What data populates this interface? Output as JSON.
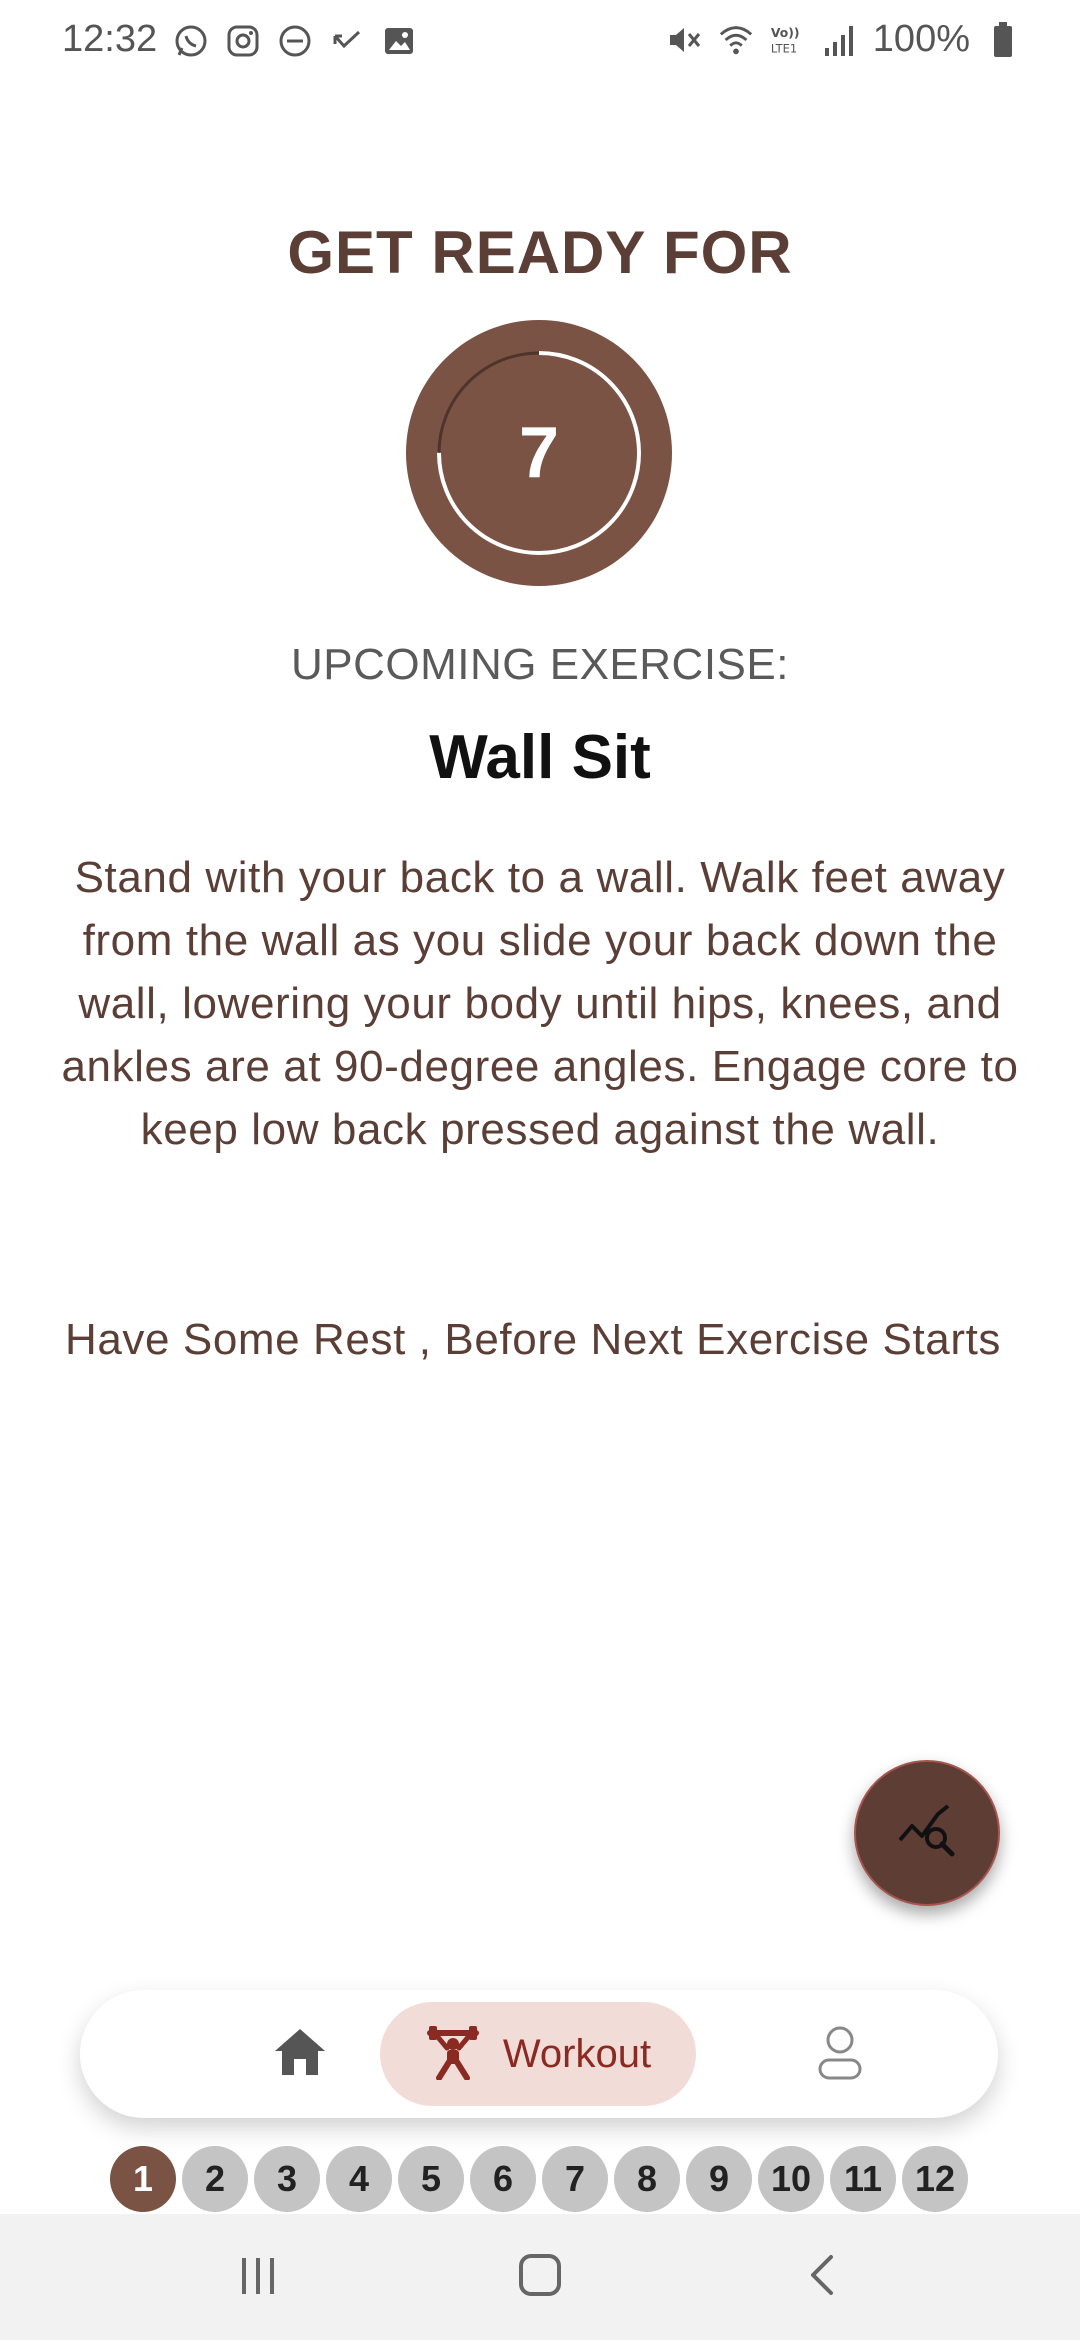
{
  "status_bar": {
    "time": "12:32",
    "battery": "100%",
    "left_icons": [
      "whatsapp-icon",
      "instagram-icon",
      "do-not-disturb-icon",
      "missed-call-icon",
      "image-icon"
    ],
    "right_icons": [
      "mute-icon",
      "wifi-icon",
      "volte-icon",
      "signal-icon",
      "battery-icon"
    ]
  },
  "main": {
    "title": "GET READY FOR",
    "timer_value": "7",
    "timer_progress": 0.75,
    "upcoming_label": "UPCOMING EXERCISE:",
    "exercise_name": "Wall Sit",
    "description": "Stand with your back to a wall. Walk feet away from the wall as you slide your back down the wall, lowering your body until hips, knees, and ankles are at 90-degree angles. Engage core to keep low back pressed against the wall.",
    "rest_note": "Have Some Rest , Before Next Exercise Starts"
  },
  "fab": {
    "icon": "chart-search-icon"
  },
  "bottom_nav": {
    "home_icon": "home-icon",
    "workout_label": "Workout",
    "workout_icon": "weightlifter-icon",
    "profile_icon": "person-icon",
    "active": "Workout"
  },
  "steps": {
    "labels": [
      "1",
      "2",
      "3",
      "4",
      "5",
      "6",
      "7",
      "8",
      "9",
      "10",
      "11",
      "12"
    ],
    "current": "1"
  },
  "colors": {
    "primary": "#7a5344",
    "dark_primary": "#5e3d35",
    "text_brown": "#5b3f36",
    "nav_active_bg": "#f2dcd8",
    "nav_active_text": "#8a2a22",
    "step_inactive": "#c4c4c4"
  }
}
